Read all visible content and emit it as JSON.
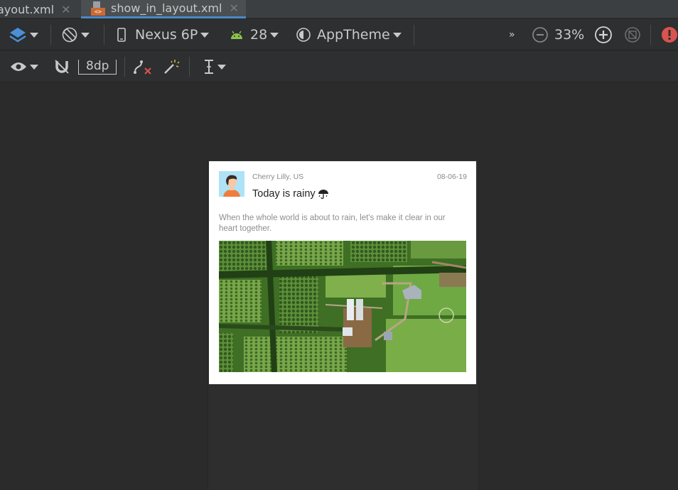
{
  "tabs": [
    {
      "label": "ayout.xml",
      "active": false
    },
    {
      "label": "show_in_layout.xml",
      "active": true,
      "badge": "<>"
    }
  ],
  "toolbar": {
    "layers_icon": "layers-icon",
    "orientation_icon": "rotate-icon",
    "device": "Nexus 6P",
    "api_level": "28",
    "theme": "AppTheme",
    "overflow": "»",
    "zoom": "33%",
    "accent_error": "#d9534f",
    "android_green": "#8bc34a"
  },
  "toolbar2": {
    "margin": "8dp"
  },
  "card": {
    "author": "Cherry Lilly, US",
    "date": "08-06-19",
    "title": "Today is rainy",
    "body": "When the whole world is about to rain, let's make it clear in our heart together."
  }
}
